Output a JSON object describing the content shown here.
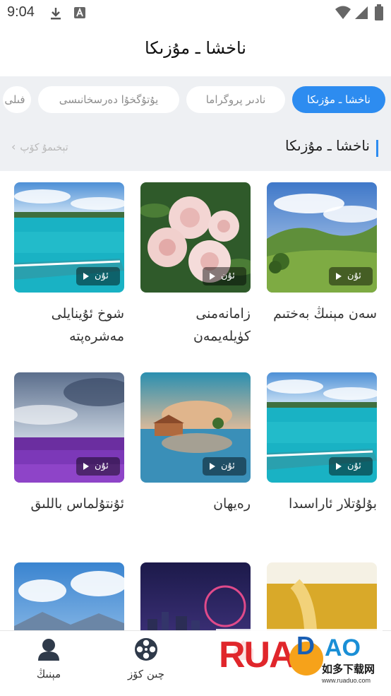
{
  "status_bar": {
    "time": "9:04",
    "icons": [
      "download-icon",
      "app-a-icon",
      "wifi-icon",
      "signal-icon",
      "battery-icon"
    ]
  },
  "header": {
    "title": "ناخشا ـ مۇزىكا"
  },
  "tabs": [
    {
      "label": "ناخشا ـ مۇزىكا",
      "active": true
    },
    {
      "label": "نادىر پروگراما",
      "active": false
    },
    {
      "label": "يۇتۇگخۇا دەرسخانىسى",
      "active": false
    },
    {
      "label": "فىلى",
      "active": false
    }
  ],
  "section": {
    "title": "ناخشا ـ مۇزىكا",
    "more_label": "تېخىمۇ كۆپ"
  },
  "play_label": "ئۇن",
  "cards": [
    {
      "title": "سەن مېنىڭ بەختىم",
      "image": "green-hills-landscape"
    },
    {
      "title": "زامانەمنى كۈيلەيمەن",
      "image": "pink-roses"
    },
    {
      "title": "شوخ ئۇينايلى مەشرەپتە",
      "image": "turquoise-sea-boat"
    },
    {
      "title": "بۇلۇتلار ئاراسىدا",
      "image": "turquoise-sea-boat"
    },
    {
      "title": "رەيھان",
      "image": "lake-house-reflection"
    },
    {
      "title": "ئۇنتۇلماس باللىق",
      "image": "purple-flower-field"
    },
    {
      "title": "",
      "image": "golden-wheat-field"
    },
    {
      "title": "",
      "image": "city-night-ferris-wheel"
    },
    {
      "title": "",
      "image": "clouds-mountains"
    }
  ],
  "bottom_nav": [
    {
      "label": "مېنىڭ",
      "icon": "user-icon",
      "active": false
    },
    {
      "label": "چىن كۆز",
      "icon": "film-reel-icon",
      "active": false
    },
    {
      "label": "",
      "icon": "home-icon",
      "active": true
    }
  ],
  "watermark": {
    "brand": "RUANDAO",
    "cn_text": "如多下载网",
    "url": "www.ruaduo.com"
  },
  "colors": {
    "accent": "#2d8cf0",
    "background": "#eef0f3",
    "nav_active": "#e23a3a"
  }
}
